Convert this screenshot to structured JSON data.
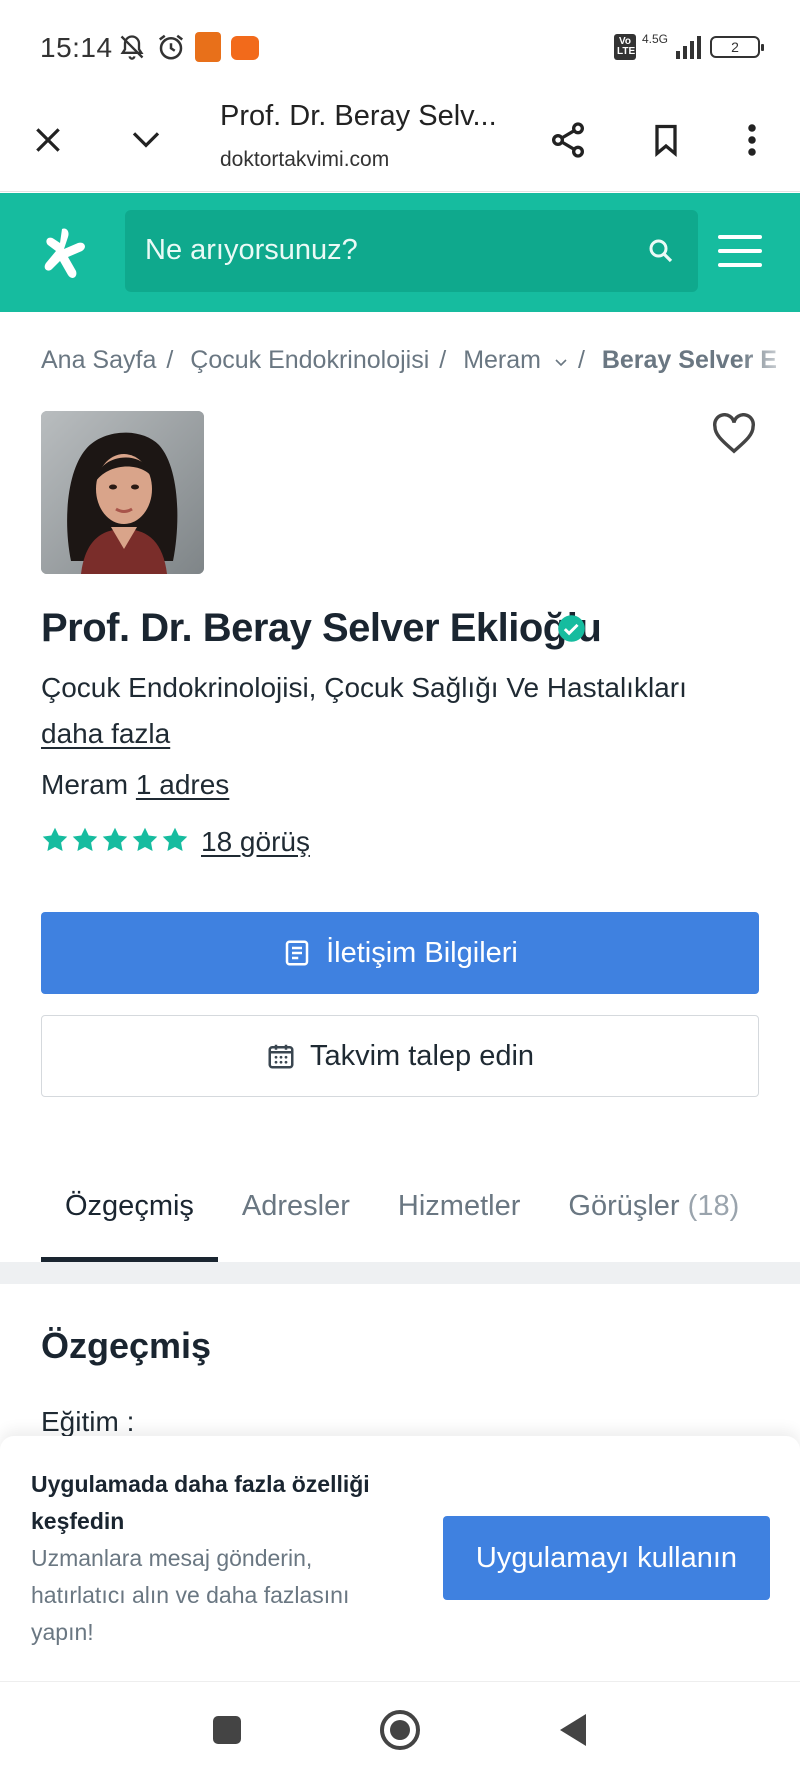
{
  "status_bar": {
    "time": "15:14",
    "network": "4.5G",
    "volte": "Vo LTE",
    "battery": "2",
    "icons": [
      "bell-off-icon",
      "alarm-icon",
      "app-notification-icon",
      "trendyol-notification-icon",
      "signal-icon"
    ]
  },
  "browser": {
    "title": "Prof. Dr. Beray Selv...",
    "url": "doktortakvimi.com",
    "icons": [
      "close-icon",
      "chevron-down-icon",
      "share-icon",
      "bookmark-icon",
      "more-vert-icon"
    ]
  },
  "header": {
    "search_placeholder": "Ne arıyorsunuz?",
    "brand_color": "#16bc9f"
  },
  "breadcrumb": {
    "items": [
      "Ana Sayfa",
      "Çocuk Endokrinolojisi",
      "Meram",
      "Beray Selver E"
    ]
  },
  "profile": {
    "name": "Prof. Dr. Beray Selver Eklioğlu",
    "specialty": "Çocuk Endokrinolojisi, Çocuk Sağlığı Ve Hastalıkları",
    "more_link": "daha fazla",
    "location": "Meram",
    "address_link": "1 adres",
    "rating_stars": 5,
    "reviews_link": "18 görüş"
  },
  "actions": {
    "primary_label": "İletişim Bilgileri",
    "secondary_label": "Takvim talep edin",
    "primary_color": "#3f81e0"
  },
  "tabs": [
    {
      "label": "Özgeçmiş",
      "count": ""
    },
    {
      "label": "Adresler",
      "count": ""
    },
    {
      "label": "Hizmetler",
      "count": ""
    },
    {
      "label": "Görüşler",
      "count": "(18)"
    }
  ],
  "section": {
    "title": "Özgeçmiş",
    "education_label": "Eğitim :"
  },
  "promo": {
    "title": "Uygulamada daha fazla özelliği keşfedin",
    "description": "Uzmanlara mesaj gönderin, hatırlatıcı alın ve daha fazlasını yapın!",
    "button_label": "Uygulamayı kullanın"
  }
}
